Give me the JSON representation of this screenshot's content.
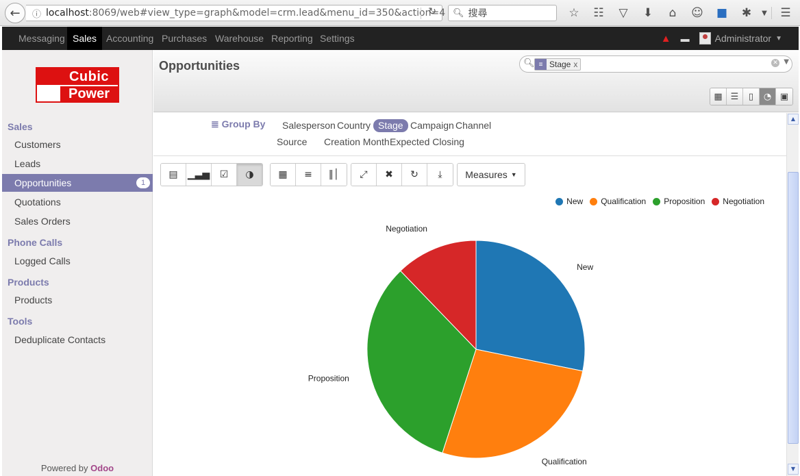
{
  "browser": {
    "url_host": "localhost",
    "url_rest": ":8069/web#view_type=graph&model=crm.lead&menu_id=350&action=4",
    "search_placeholder": "搜尋"
  },
  "topnav": {
    "items": [
      "Messaging",
      "Sales",
      "Accounting",
      "Purchases",
      "Warehouse",
      "Reporting",
      "Settings"
    ],
    "active": "Sales",
    "user": "Administrator"
  },
  "sidebar": {
    "logo_line1": "Cubic",
    "logo_line2": "Power",
    "sections": [
      {
        "title": "Sales",
        "items": [
          "Customers",
          "Leads",
          "Opportunities",
          "Quotations",
          "Sales Orders"
        ]
      },
      {
        "title": "Phone Calls",
        "items": [
          "Logged Calls"
        ]
      },
      {
        "title": "Products",
        "items": [
          "Products"
        ]
      },
      {
        "title": "Tools",
        "items": [
          "Deduplicate Contacts"
        ]
      }
    ],
    "active_item": "Opportunities",
    "active_badge": "1",
    "powered_by": "Powered by",
    "powered_brand": "Odoo"
  },
  "header": {
    "title": "Opportunities",
    "facet_label": "Stage",
    "facet_remove": "x"
  },
  "groupby": {
    "label": "Group By",
    "row1": [
      "Salesperson",
      "Country",
      "Stage",
      "Campaign",
      "Channel"
    ],
    "row2": [
      "Source",
      "Creation Month",
      "Expected Closing"
    ],
    "selected": "Stage"
  },
  "toolbar": {
    "measures_label": "Measures"
  },
  "colors": {
    "accent": "#7c7bad",
    "new": "#1f77b4",
    "qualification": "#ff7f0e",
    "proposition": "#2ca02c",
    "negotiation": "#d62728"
  },
  "chart_data": {
    "type": "pie",
    "categories": [
      "New",
      "Qualification",
      "Proposition",
      "Negotiation"
    ],
    "values": [
      28.2,
      26.8,
      32.8,
      12.2
    ],
    "colors": [
      "#1f77b4",
      "#ff7f0e",
      "#2ca02c",
      "#d62728"
    ],
    "legend_position": "top-right"
  }
}
